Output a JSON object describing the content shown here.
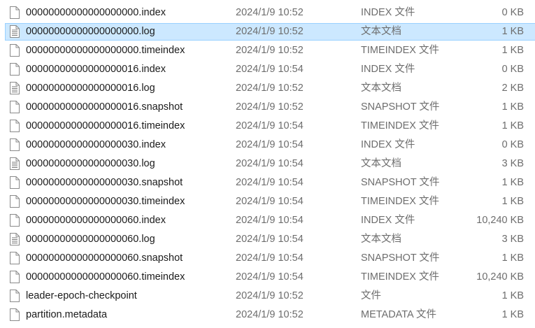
{
  "files": [
    {
      "name": "00000000000000000000.index",
      "date": "2024/1/9 10:52",
      "type": "INDEX 文件",
      "size": "0 KB",
      "icon": "blank-file-icon",
      "selected": false
    },
    {
      "name": "00000000000000000000.log",
      "date": "2024/1/9 10:52",
      "type": "文本文档",
      "size": "1 KB",
      "icon": "text-file-icon",
      "selected": true
    },
    {
      "name": "00000000000000000000.timeindex",
      "date": "2024/1/9 10:52",
      "type": "TIMEINDEX 文件",
      "size": "1 KB",
      "icon": "blank-file-icon",
      "selected": false
    },
    {
      "name": "00000000000000000016.index",
      "date": "2024/1/9 10:54",
      "type": "INDEX 文件",
      "size": "0 KB",
      "icon": "blank-file-icon",
      "selected": false
    },
    {
      "name": "00000000000000000016.log",
      "date": "2024/1/9 10:52",
      "type": "文本文档",
      "size": "2 KB",
      "icon": "text-file-icon",
      "selected": false
    },
    {
      "name": "00000000000000000016.snapshot",
      "date": "2024/1/9 10:52",
      "type": "SNAPSHOT 文件",
      "size": "1 KB",
      "icon": "blank-file-icon",
      "selected": false
    },
    {
      "name": "00000000000000000016.timeindex",
      "date": "2024/1/9 10:54",
      "type": "TIMEINDEX 文件",
      "size": "1 KB",
      "icon": "blank-file-icon",
      "selected": false
    },
    {
      "name": "00000000000000000030.index",
      "date": "2024/1/9 10:54",
      "type": "INDEX 文件",
      "size": "0 KB",
      "icon": "blank-file-icon",
      "selected": false
    },
    {
      "name": "00000000000000000030.log",
      "date": "2024/1/9 10:54",
      "type": "文本文档",
      "size": "3 KB",
      "icon": "text-file-icon",
      "selected": false
    },
    {
      "name": "00000000000000000030.snapshot",
      "date": "2024/1/9 10:54",
      "type": "SNAPSHOT 文件",
      "size": "1 KB",
      "icon": "blank-file-icon",
      "selected": false
    },
    {
      "name": "00000000000000000030.timeindex",
      "date": "2024/1/9 10:54",
      "type": "TIMEINDEX 文件",
      "size": "1 KB",
      "icon": "blank-file-icon",
      "selected": false
    },
    {
      "name": "00000000000000000060.index",
      "date": "2024/1/9 10:54",
      "type": "INDEX 文件",
      "size": "10,240 KB",
      "icon": "blank-file-icon",
      "selected": false
    },
    {
      "name": "00000000000000000060.log",
      "date": "2024/1/9 10:54",
      "type": "文本文档",
      "size": "3 KB",
      "icon": "text-file-icon",
      "selected": false
    },
    {
      "name": "00000000000000000060.snapshot",
      "date": "2024/1/9 10:54",
      "type": "SNAPSHOT 文件",
      "size": "1 KB",
      "icon": "blank-file-icon",
      "selected": false
    },
    {
      "name": "00000000000000000060.timeindex",
      "date": "2024/1/9 10:54",
      "type": "TIMEINDEX 文件",
      "size": "10,240 KB",
      "icon": "blank-file-icon",
      "selected": false
    },
    {
      "name": "leader-epoch-checkpoint",
      "date": "2024/1/9 10:52",
      "type": "文件",
      "size": "1 KB",
      "icon": "blank-file-icon",
      "selected": false
    },
    {
      "name": "partition.metadata",
      "date": "2024/1/9 10:52",
      "type": "METADATA 文件",
      "size": "1 KB",
      "icon": "blank-file-icon",
      "selected": false
    }
  ],
  "colors": {
    "selection_fill": "#cce8ff",
    "selection_border": "#99d1ff",
    "name_text": "#1b1b1b",
    "detail_text": "#6d6d6d"
  }
}
